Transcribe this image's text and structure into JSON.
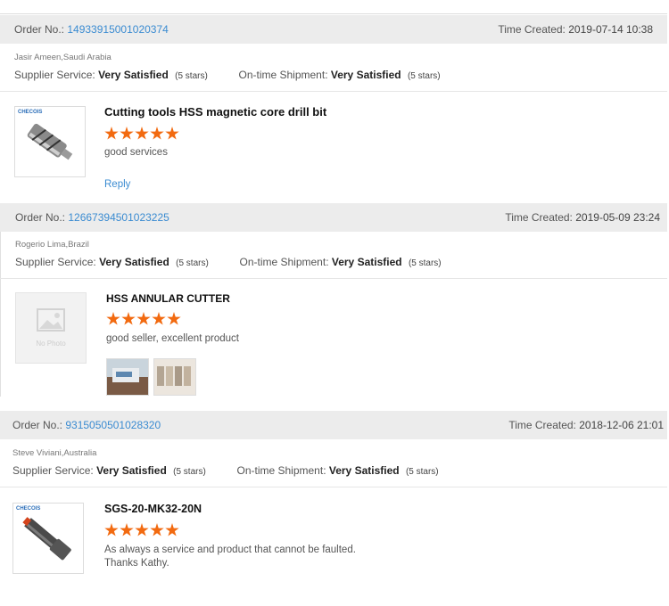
{
  "labels": {
    "order_no": "Order No.:",
    "time_created": "Time Created:",
    "supplier_service": "Supplier Service:",
    "on_time_shipment": "On-time Shipment:",
    "reply": "Reply",
    "no_photo": "No Photo"
  },
  "reviews": [
    {
      "order_no": "14933915001020374",
      "time_created": "2019-07-14 10:38",
      "buyer": "Jasir Ameen,Saudi Arabia",
      "supplier_service": "Very Satisfied",
      "supplier_stars": "(5 stars)",
      "shipment": "Very Satisfied",
      "shipment_stars": "(5 stars)",
      "product": "Cutting tools HSS magnetic core drill bit",
      "rating": 5,
      "comment": "good services",
      "thumb_brand": "CHECOIS"
    },
    {
      "order_no": "12667394501023225",
      "time_created": "2019-05-09 23:24",
      "buyer": "Rogerio Lima,Brazil",
      "supplier_service": "Very Satisfied",
      "supplier_stars": "(5 stars)",
      "shipment": "Very Satisfied",
      "shipment_stars": "(5 stars)",
      "product": "HSS ANNULAR CUTTER",
      "rating": 5,
      "comment": "good seller, excellent product"
    },
    {
      "order_no": "9315050501028320",
      "time_created": "2018-12-06 21:01",
      "buyer": "Steve Viviani,Australia",
      "supplier_service": "Very Satisfied",
      "supplier_stars": "(5 stars)",
      "shipment": "Very Satisfied",
      "shipment_stars": "(5 stars)",
      "product": "SGS-20-MK32-20N",
      "rating": 5,
      "comment_line1": "As always a service and product that cannot be faulted.",
      "comment_line2": "Thanks Kathy.",
      "thumb_brand": "CHECOIS"
    }
  ]
}
